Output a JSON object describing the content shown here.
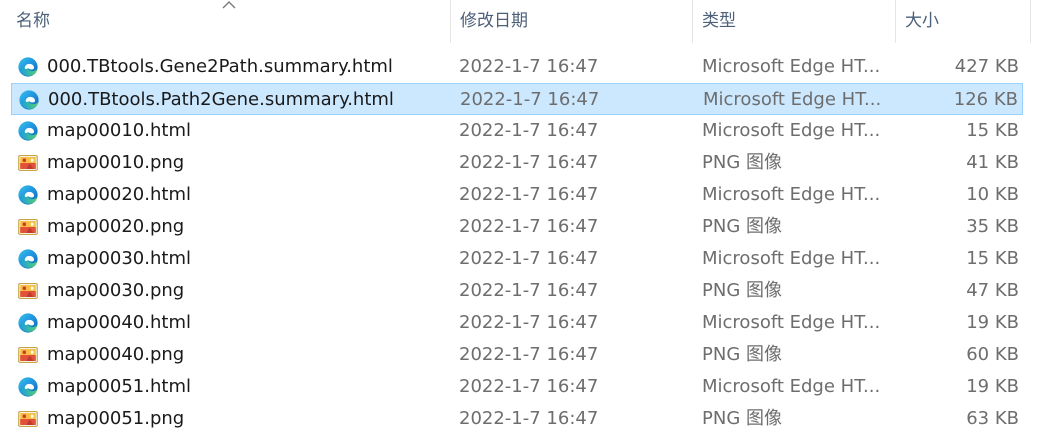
{
  "columns": {
    "name": "名称",
    "date_modified": "修改日期",
    "type": "类型",
    "size": "大小"
  },
  "sort_indicator": "chevron-up-icon",
  "selected_index": 1,
  "files": [
    {
      "name": "000.TBtools.Gene2Path.summary.html",
      "date": "2022-1-7 16:47",
      "type": "Microsoft Edge HT...",
      "size": "427 KB",
      "icon": "edge-icon"
    },
    {
      "name": "000.TBtools.Path2Gene.summary.html",
      "date": "2022-1-7 16:47",
      "type": "Microsoft Edge HT...",
      "size": "126 KB",
      "icon": "edge-icon"
    },
    {
      "name": "map00010.html",
      "date": "2022-1-7 16:47",
      "type": "Microsoft Edge HT...",
      "size": "15 KB",
      "icon": "edge-icon"
    },
    {
      "name": "map00010.png",
      "date": "2022-1-7 16:47",
      "type": "PNG 图像",
      "size": "41 KB",
      "icon": "png-image-icon"
    },
    {
      "name": "map00020.html",
      "date": "2022-1-7 16:47",
      "type": "Microsoft Edge HT...",
      "size": "10 KB",
      "icon": "edge-icon"
    },
    {
      "name": "map00020.png",
      "date": "2022-1-7 16:47",
      "type": "PNG 图像",
      "size": "35 KB",
      "icon": "png-image-icon"
    },
    {
      "name": "map00030.html",
      "date": "2022-1-7 16:47",
      "type": "Microsoft Edge HT...",
      "size": "15 KB",
      "icon": "edge-icon"
    },
    {
      "name": "map00030.png",
      "date": "2022-1-7 16:47",
      "type": "PNG 图像",
      "size": "47 KB",
      "icon": "png-image-icon"
    },
    {
      "name": "map00040.html",
      "date": "2022-1-7 16:47",
      "type": "Microsoft Edge HT...",
      "size": "19 KB",
      "icon": "edge-icon"
    },
    {
      "name": "map00040.png",
      "date": "2022-1-7 16:47",
      "type": "PNG 图像",
      "size": "60 KB",
      "icon": "png-image-icon"
    },
    {
      "name": "map00051.html",
      "date": "2022-1-7 16:47",
      "type": "Microsoft Edge HT...",
      "size": "19 KB",
      "icon": "edge-icon"
    },
    {
      "name": "map00051.png",
      "date": "2022-1-7 16:47",
      "type": "PNG 图像",
      "size": "63 KB",
      "icon": "png-image-icon"
    }
  ],
  "colors": {
    "selection_background": "#cce8ff",
    "selection_border": "#99d1ff",
    "header_text": "#4c607a",
    "secondary_text": "#6d6d6d"
  }
}
